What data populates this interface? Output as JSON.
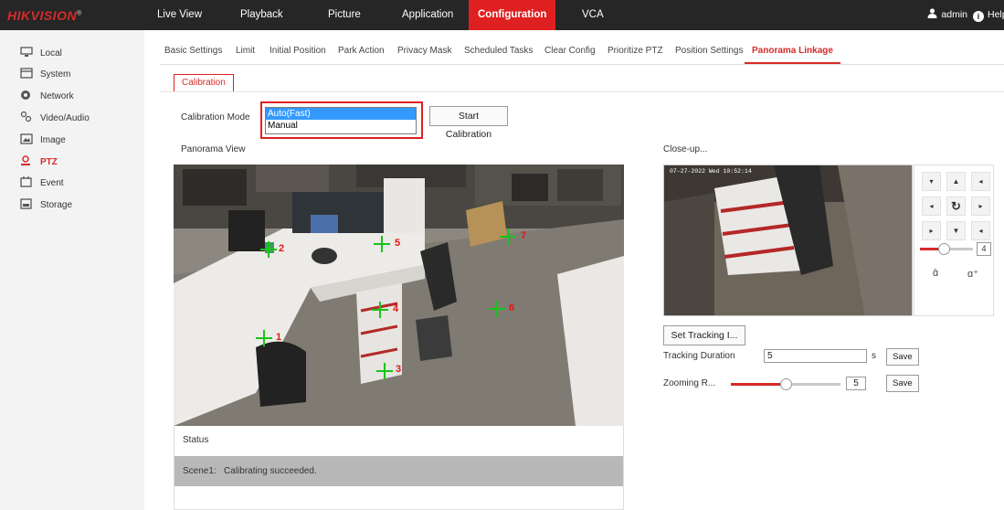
{
  "header": {
    "logo": "HIKVISION",
    "nav": [
      "Live View",
      "Playback",
      "Picture",
      "Application",
      "Configuration",
      "VCA"
    ],
    "active_nav": "Configuration",
    "user": "admin",
    "help": "Help"
  },
  "sidebar": {
    "items": [
      {
        "label": "Local",
        "icon": "monitor-icon"
      },
      {
        "label": "System",
        "icon": "system-icon"
      },
      {
        "label": "Network",
        "icon": "network-icon"
      },
      {
        "label": "Video/Audio",
        "icon": "video-audio-icon"
      },
      {
        "label": "Image",
        "icon": "image-icon"
      },
      {
        "label": "PTZ",
        "icon": "ptz-icon"
      },
      {
        "label": "Event",
        "icon": "event-icon"
      },
      {
        "label": "Storage",
        "icon": "storage-icon"
      }
    ],
    "active": "PTZ"
  },
  "tabs": [
    "Basic Settings",
    "Limit",
    "Initial Position",
    "Park Action",
    "Privacy Mask",
    "Scheduled Tasks",
    "Clear Config",
    "Prioritize PTZ",
    "Position Settings",
    "Panorama Linkage"
  ],
  "active_tab": "Panorama Linkage",
  "subtab": "Calibration",
  "calibration": {
    "mode_label": "Calibration Mode",
    "options": [
      "Auto(Fast)",
      "Manual"
    ],
    "selected": "Auto(Fast)",
    "start_button": "Start Calibration"
  },
  "panorama": {
    "title": "Panorama View",
    "points": [
      "1",
      "2",
      "3",
      "4",
      "5",
      "6",
      "7"
    ],
    "status_title": "Status",
    "status_scene": "Scene1:",
    "status_message": "Calibrating succeeded."
  },
  "closeup": {
    "title": "Close-up...",
    "timestamp": "07-27-2022 Wed 10:52:14"
  },
  "ptz": {
    "zoom_value": "4",
    "zoom_fraction": 0.45
  },
  "tracking": {
    "set_button": "Set Tracking I...",
    "duration_label": "Tracking Duration",
    "duration_value": "5",
    "duration_unit": "s",
    "save": "Save",
    "zoom_label": "Zooming R...",
    "zoom_value": "5",
    "zoom_fraction": 0.5
  },
  "colors": {
    "accent": "#e02020",
    "nav_bg": "#262626",
    "marker": "#19c419",
    "marker_label": "#e01818"
  }
}
